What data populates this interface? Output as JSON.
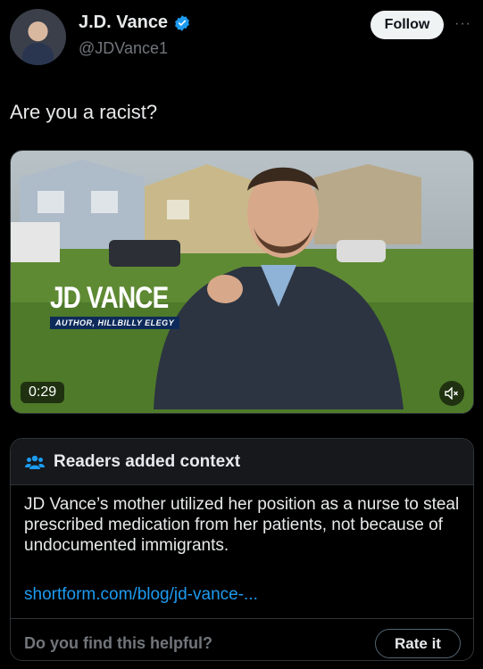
{
  "author": {
    "display_name": "J.D. Vance",
    "handle": "@JDVance1",
    "verified": true,
    "avatar_icon": "profile-photo"
  },
  "actions": {
    "follow_label": "Follow",
    "more_icon": "more-icon"
  },
  "tweet": {
    "text": "Are you a racist?"
  },
  "media": {
    "overlay_title": "JD VANCE",
    "overlay_subtitle": "AUTHOR, HILLBILLY ELEGY",
    "duration": "0:29",
    "mute_icon": "muted-speaker-icon"
  },
  "context": {
    "title": "Readers added context",
    "body": "JD Vance’s mother utilized her position as a nurse to steal prescribed medication from her patients, not because of undocumented immigrants.",
    "link": "shortform.com/blog/jd-vance-...",
    "question": "Do you find this helpful?",
    "rate_label": "Rate it"
  },
  "colors": {
    "background": "#000000",
    "accent_blue": "#1d9bf0",
    "secondary_text": "#71767b",
    "verified_blue": "#1d9bf0"
  }
}
